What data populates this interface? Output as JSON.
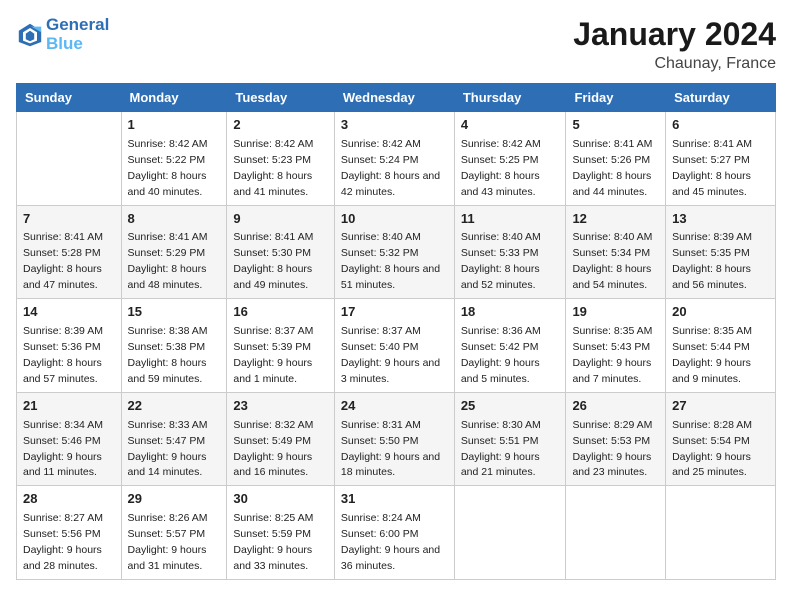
{
  "header": {
    "logo_line1": "General",
    "logo_line2": "Blue",
    "title": "January 2024",
    "subtitle": "Chaunay, France"
  },
  "columns": [
    "Sunday",
    "Monday",
    "Tuesday",
    "Wednesday",
    "Thursday",
    "Friday",
    "Saturday"
  ],
  "weeks": [
    [
      {
        "day": "",
        "sunrise": "",
        "sunset": "",
        "daylight": ""
      },
      {
        "day": "1",
        "sunrise": "Sunrise: 8:42 AM",
        "sunset": "Sunset: 5:22 PM",
        "daylight": "Daylight: 8 hours and 40 minutes."
      },
      {
        "day": "2",
        "sunrise": "Sunrise: 8:42 AM",
        "sunset": "Sunset: 5:23 PM",
        "daylight": "Daylight: 8 hours and 41 minutes."
      },
      {
        "day": "3",
        "sunrise": "Sunrise: 8:42 AM",
        "sunset": "Sunset: 5:24 PM",
        "daylight": "Daylight: 8 hours and 42 minutes."
      },
      {
        "day": "4",
        "sunrise": "Sunrise: 8:42 AM",
        "sunset": "Sunset: 5:25 PM",
        "daylight": "Daylight: 8 hours and 43 minutes."
      },
      {
        "day": "5",
        "sunrise": "Sunrise: 8:41 AM",
        "sunset": "Sunset: 5:26 PM",
        "daylight": "Daylight: 8 hours and 44 minutes."
      },
      {
        "day": "6",
        "sunrise": "Sunrise: 8:41 AM",
        "sunset": "Sunset: 5:27 PM",
        "daylight": "Daylight: 8 hours and 45 minutes."
      }
    ],
    [
      {
        "day": "7",
        "sunrise": "Sunrise: 8:41 AM",
        "sunset": "Sunset: 5:28 PM",
        "daylight": "Daylight: 8 hours and 47 minutes."
      },
      {
        "day": "8",
        "sunrise": "Sunrise: 8:41 AM",
        "sunset": "Sunset: 5:29 PM",
        "daylight": "Daylight: 8 hours and 48 minutes."
      },
      {
        "day": "9",
        "sunrise": "Sunrise: 8:41 AM",
        "sunset": "Sunset: 5:30 PM",
        "daylight": "Daylight: 8 hours and 49 minutes."
      },
      {
        "day": "10",
        "sunrise": "Sunrise: 8:40 AM",
        "sunset": "Sunset: 5:32 PM",
        "daylight": "Daylight: 8 hours and 51 minutes."
      },
      {
        "day": "11",
        "sunrise": "Sunrise: 8:40 AM",
        "sunset": "Sunset: 5:33 PM",
        "daylight": "Daylight: 8 hours and 52 minutes."
      },
      {
        "day": "12",
        "sunrise": "Sunrise: 8:40 AM",
        "sunset": "Sunset: 5:34 PM",
        "daylight": "Daylight: 8 hours and 54 minutes."
      },
      {
        "day": "13",
        "sunrise": "Sunrise: 8:39 AM",
        "sunset": "Sunset: 5:35 PM",
        "daylight": "Daylight: 8 hours and 56 minutes."
      }
    ],
    [
      {
        "day": "14",
        "sunrise": "Sunrise: 8:39 AM",
        "sunset": "Sunset: 5:36 PM",
        "daylight": "Daylight: 8 hours and 57 minutes."
      },
      {
        "day": "15",
        "sunrise": "Sunrise: 8:38 AM",
        "sunset": "Sunset: 5:38 PM",
        "daylight": "Daylight: 8 hours and 59 minutes."
      },
      {
        "day": "16",
        "sunrise": "Sunrise: 8:37 AM",
        "sunset": "Sunset: 5:39 PM",
        "daylight": "Daylight: 9 hours and 1 minute."
      },
      {
        "day": "17",
        "sunrise": "Sunrise: 8:37 AM",
        "sunset": "Sunset: 5:40 PM",
        "daylight": "Daylight: 9 hours and 3 minutes."
      },
      {
        "day": "18",
        "sunrise": "Sunrise: 8:36 AM",
        "sunset": "Sunset: 5:42 PM",
        "daylight": "Daylight: 9 hours and 5 minutes."
      },
      {
        "day": "19",
        "sunrise": "Sunrise: 8:35 AM",
        "sunset": "Sunset: 5:43 PM",
        "daylight": "Daylight: 9 hours and 7 minutes."
      },
      {
        "day": "20",
        "sunrise": "Sunrise: 8:35 AM",
        "sunset": "Sunset: 5:44 PM",
        "daylight": "Daylight: 9 hours and 9 minutes."
      }
    ],
    [
      {
        "day": "21",
        "sunrise": "Sunrise: 8:34 AM",
        "sunset": "Sunset: 5:46 PM",
        "daylight": "Daylight: 9 hours and 11 minutes."
      },
      {
        "day": "22",
        "sunrise": "Sunrise: 8:33 AM",
        "sunset": "Sunset: 5:47 PM",
        "daylight": "Daylight: 9 hours and 14 minutes."
      },
      {
        "day": "23",
        "sunrise": "Sunrise: 8:32 AM",
        "sunset": "Sunset: 5:49 PM",
        "daylight": "Daylight: 9 hours and 16 minutes."
      },
      {
        "day": "24",
        "sunrise": "Sunrise: 8:31 AM",
        "sunset": "Sunset: 5:50 PM",
        "daylight": "Daylight: 9 hours and 18 minutes."
      },
      {
        "day": "25",
        "sunrise": "Sunrise: 8:30 AM",
        "sunset": "Sunset: 5:51 PM",
        "daylight": "Daylight: 9 hours and 21 minutes."
      },
      {
        "day": "26",
        "sunrise": "Sunrise: 8:29 AM",
        "sunset": "Sunset: 5:53 PM",
        "daylight": "Daylight: 9 hours and 23 minutes."
      },
      {
        "day": "27",
        "sunrise": "Sunrise: 8:28 AM",
        "sunset": "Sunset: 5:54 PM",
        "daylight": "Daylight: 9 hours and 25 minutes."
      }
    ],
    [
      {
        "day": "28",
        "sunrise": "Sunrise: 8:27 AM",
        "sunset": "Sunset: 5:56 PM",
        "daylight": "Daylight: 9 hours and 28 minutes."
      },
      {
        "day": "29",
        "sunrise": "Sunrise: 8:26 AM",
        "sunset": "Sunset: 5:57 PM",
        "daylight": "Daylight: 9 hours and 31 minutes."
      },
      {
        "day": "30",
        "sunrise": "Sunrise: 8:25 AM",
        "sunset": "Sunset: 5:59 PM",
        "daylight": "Daylight: 9 hours and 33 minutes."
      },
      {
        "day": "31",
        "sunrise": "Sunrise: 8:24 AM",
        "sunset": "Sunset: 6:00 PM",
        "daylight": "Daylight: 9 hours and 36 minutes."
      },
      {
        "day": "",
        "sunrise": "",
        "sunset": "",
        "daylight": ""
      },
      {
        "day": "",
        "sunrise": "",
        "sunset": "",
        "daylight": ""
      },
      {
        "day": "",
        "sunrise": "",
        "sunset": "",
        "daylight": ""
      }
    ]
  ]
}
